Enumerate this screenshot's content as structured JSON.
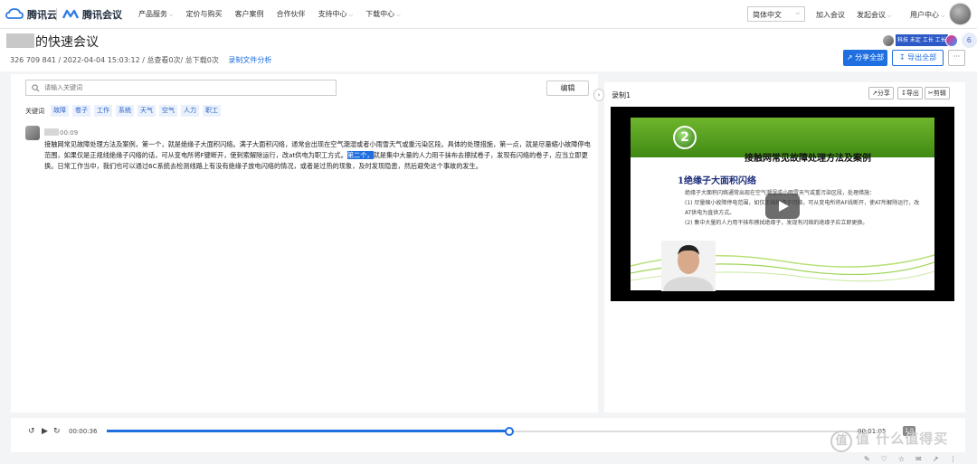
{
  "nav": {
    "brand_cloud": "腾讯云",
    "brand_meeting": "腾讯会议",
    "menu": [
      {
        "label": "产品服务",
        "dropdown": true
      },
      {
        "label": "定价与购买",
        "dropdown": false
      },
      {
        "label": "客户案例",
        "dropdown": false
      },
      {
        "label": "合作伙伴",
        "dropdown": false
      },
      {
        "label": "支持中心",
        "dropdown": true
      },
      {
        "label": "下载中心",
        "dropdown": true
      }
    ],
    "language": "简体中文",
    "join_meeting": "加入会议",
    "start_meeting": "发起会议",
    "user_center": "用户中心"
  },
  "meeting": {
    "title": "的快速会议",
    "id": "326 709 841",
    "datetime": "2022-04-04 15:03:12",
    "views": "总查看0次",
    "downloads": "总下载0次",
    "analysis_link": "录制文件分析",
    "participant_count": "6",
    "participant_tags": "科技 未定 工长 工长"
  },
  "actions": {
    "share_all": "分享全部",
    "export_all": "导出全部",
    "more": "···"
  },
  "transcript": {
    "search_placeholder": "请输入关键词",
    "edit_label": "编辑",
    "keywords_label": "关键词",
    "keywords": [
      "故障",
      "卷子",
      "工作",
      "系统",
      "天气",
      "空气",
      "人力",
      "职工"
    ],
    "time": "00:09",
    "text_before": "接触网常见故障处理方法及案例，第一个，就是绝缘子大面积闪络。满子大面积闪络，通常会出现在空气潮湿或者小雨雪天气或重污染区段。具体的处理措施，第一点，就是尽量缩小故障停电范围，如果仅是正规线绝缘子闪络的话，可从变电所将F键断开，使刺索解除运行，改at供电为职工方式。",
    "text_highlight": "第二个，",
    "text_after": "就是集中大量的人力用干抹布去擦拭卷子，发现有闪络的卷子，应当立即更换。日常工作当中，我们也可以通过6C系统去检测线路上有没有绝缘子放电闪络的情况，或者是过热的现象，及时发现隐患，然后避免这个事故的发生。"
  },
  "recording": {
    "title": "录制1",
    "share": "分享",
    "export": "导出",
    "clip": "剪辑",
    "slide": {
      "number": "2",
      "title": "接触网常见故障处理方法及案例",
      "heading": "1绝缘子大面积闪络",
      "body_1": "绝缘子大面积闪络通常出现在空气潮湿或小雨雪天气或重污染区段，处理措施：",
      "body_2": "(1) 尽量缩小故障停电范围，如仅正线绝缘子闪络，可从变电所将AF线断开，使AT所解除运行，改AT供电为直供方式。",
      "body_3": "(2) 集中大量的人力用干抹布擦拭绝缘子，发现有闪络的绝缘子应立即更换。"
    }
  },
  "player": {
    "current": "00:00:36",
    "total": "00:01:05",
    "progress": 0.53,
    "speed": "1.0"
  },
  "watermark": "值 什么值得买"
}
